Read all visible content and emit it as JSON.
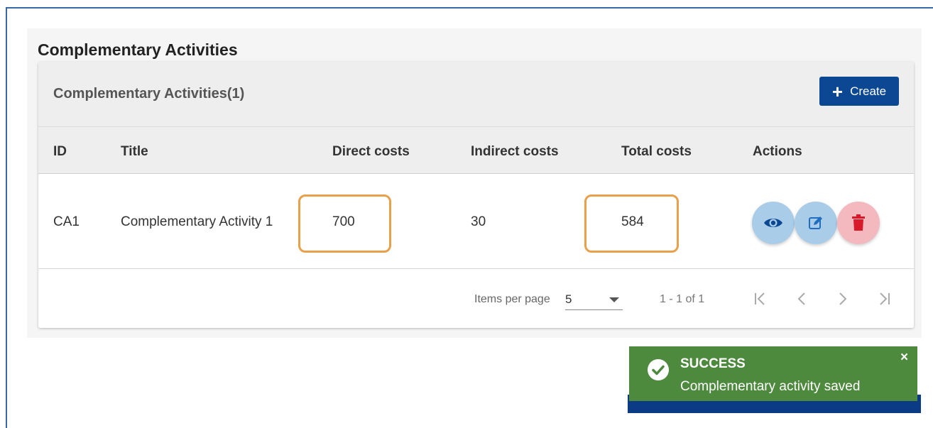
{
  "section": {
    "title": "Complementary Activities"
  },
  "card": {
    "title": "Complementary Activities(1)",
    "create_label": "Create"
  },
  "table": {
    "columns": [
      "ID",
      "Title",
      "Direct costs",
      "Indirect costs",
      "Total costs",
      "Actions"
    ],
    "rows": [
      {
        "id": "CA1",
        "title": "Complementary Activity 1",
        "direct_costs": "700",
        "indirect_costs": "30",
        "total_costs": "584"
      }
    ]
  },
  "pagination": {
    "items_per_page_label": "Items per page",
    "items_per_page_value": "5",
    "range": "1 - 1 of 1"
  },
  "toast": {
    "title": "SUCCESS",
    "message": "Complementary activity saved",
    "close": "×"
  },
  "icons": {
    "create": "plus-icon",
    "view": "eye-icon",
    "edit": "edit-icon",
    "delete": "trash-icon",
    "first": "first-page-icon",
    "prev": "chevron-left-icon",
    "next": "chevron-right-icon",
    "last": "last-page-icon",
    "success": "check-circle-icon"
  },
  "colors": {
    "primary": "#0b4792",
    "success": "#4e8a3e",
    "highlight": "#e9a04a",
    "view_bg": "#a9cde9",
    "delete_bg": "#f4b8bf",
    "delete_icon": "#d7192a"
  }
}
